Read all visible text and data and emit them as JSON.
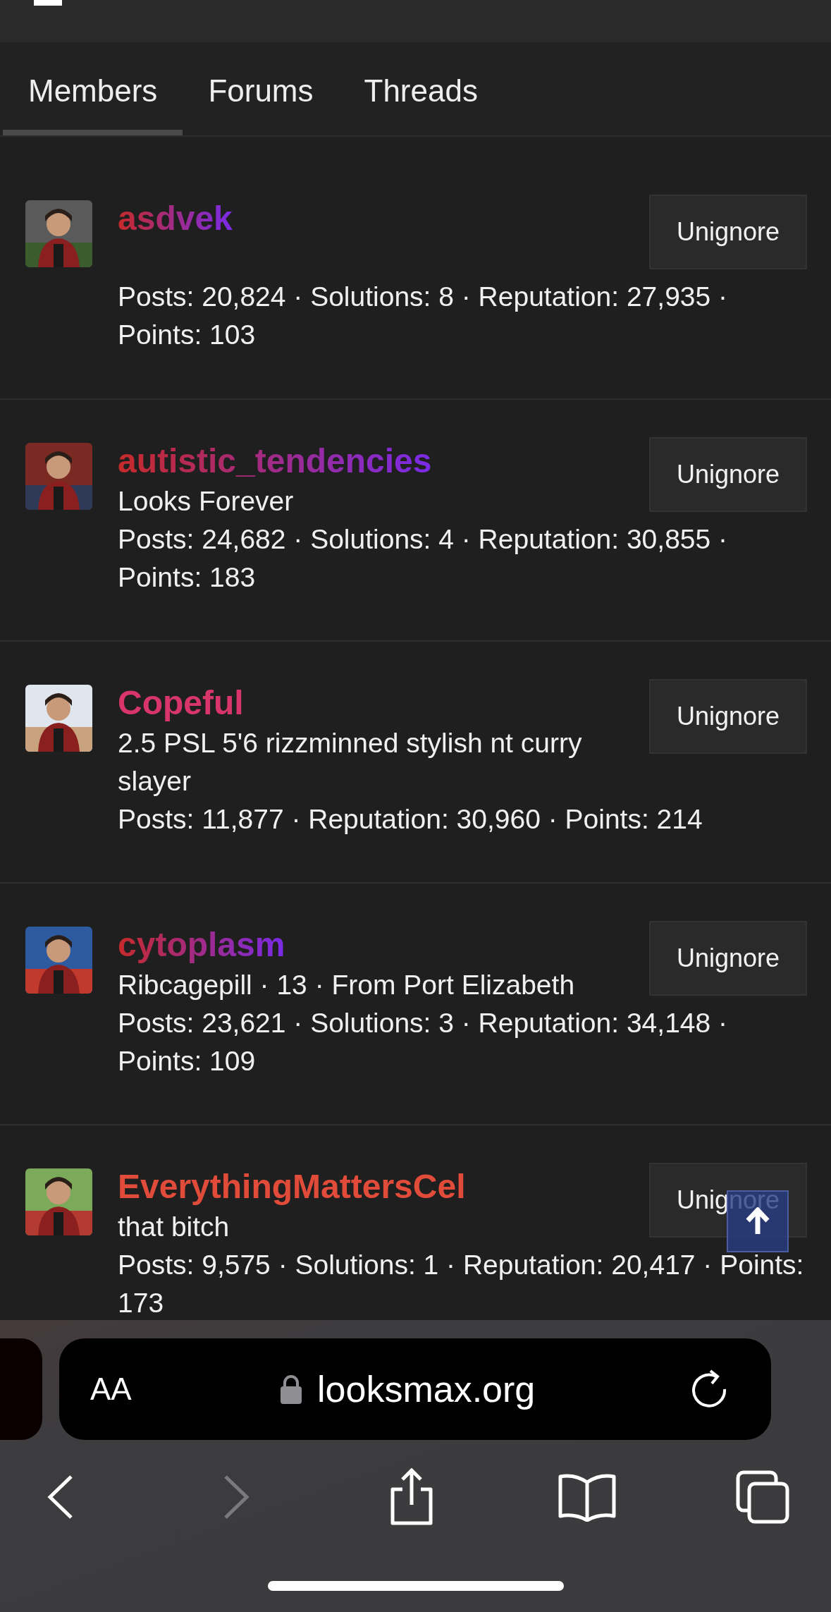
{
  "tabs": [
    {
      "label": "Members",
      "selected": true
    },
    {
      "label": "Forums",
      "selected": false
    },
    {
      "label": "Threads",
      "selected": false
    }
  ],
  "members": [
    {
      "name": "asdvek",
      "kind": "gradient",
      "stats": "Posts: 20,824 · Solutions: 8 · Reputation: 27,935 · Points: 103",
      "button": "Unignore"
    },
    {
      "name": "autistic_tendencies",
      "kind": "gradient",
      "title": "Looks Forever",
      "stats": "Posts: 24,682 · Solutions: 4 · Reputation: 30,855 · Points: 183",
      "button": "Unignore"
    },
    {
      "name": "Copeful",
      "color": "#d8366a",
      "kind": "solid",
      "title": "2.5 PSL 5'6 rizzminned stylish nt curry slayer",
      "stats": "Posts: 11,877 · Reputation: 30,960 · Points: 214",
      "button": "Unignore"
    },
    {
      "name": "cytoplasm",
      "kind": "gradient",
      "title": "Ribcagepill · 13 · From Port Elizabeth",
      "stats": "Posts: 23,621 · Solutions: 3 · Reputation: 34,148 · Points: 109",
      "button": "Unignore"
    },
    {
      "name": "EverythingMattersCel",
      "color": "#e04b3a",
      "kind": "solid",
      "title": "that bitch",
      "stats": "Posts: 9,575 · Solutions: 1 · Reputation: 20,417 · Points: 173",
      "button": "Unignore"
    }
  ],
  "browser": {
    "text_size": "AA",
    "url": "looksmax.org",
    "back_disabled": false,
    "forward_disabled": true
  }
}
